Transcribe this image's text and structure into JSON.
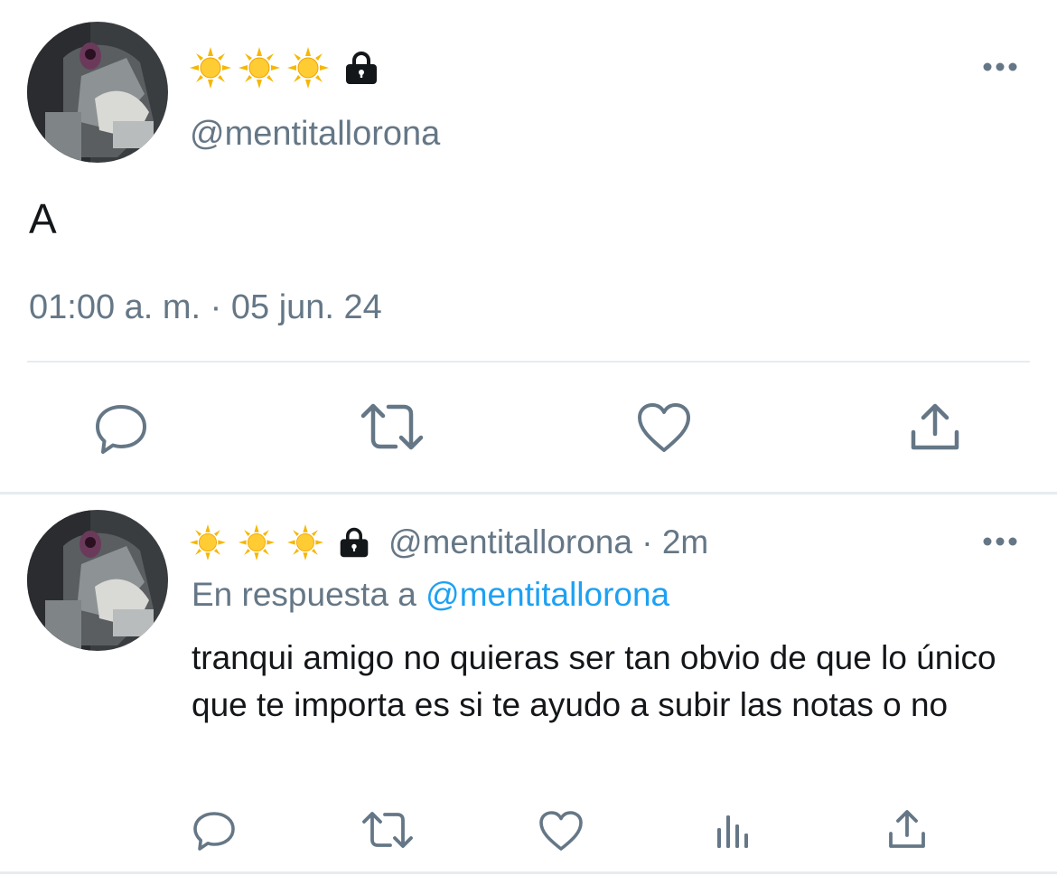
{
  "main_tweet": {
    "display_name_emoji": [
      "sun",
      "sun",
      "sun"
    ],
    "protected_icon": "lock-icon",
    "handle": "@mentitallorona",
    "text": "A",
    "timestamp": "01:00 a. m. · 05 jun. 24",
    "actions": [
      "reply-icon",
      "retweet-icon",
      "like-icon",
      "share-icon"
    ]
  },
  "reply_tweet": {
    "display_name_emoji": [
      "sun",
      "sun",
      "sun"
    ],
    "protected_icon": "lock-icon",
    "handle_meta": "@mentitallorona · 2m",
    "reply_to_prefix": "En respuesta a",
    "reply_to_handle": "@mentitallorona",
    "text": "tranqui amigo no quieras ser tan obvio de que lo único que te importa es si te ayudo a subir las notas o no",
    "actions": [
      "reply-icon",
      "retweet-icon",
      "like-icon",
      "stats-icon",
      "share-icon"
    ]
  },
  "colors": {
    "text": "#14171a",
    "secondary": "#657786",
    "link": "#1da1f2",
    "divider": "#e6ecf0"
  }
}
